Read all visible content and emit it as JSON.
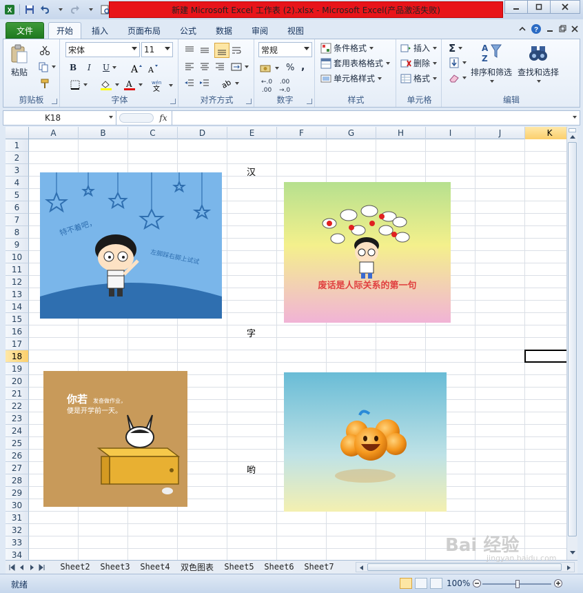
{
  "window": {
    "title": "新建 Microsoft Excel 工作表 (2).xlsx  -  Microsoft Excel(产品激活失败)"
  },
  "tabs": [
    "文件",
    "开始",
    "插入",
    "页面布局",
    "公式",
    "数据",
    "审阅",
    "视图"
  ],
  "active_tab": "开始",
  "ribbon": {
    "clipboard": {
      "label": "剪贴板",
      "paste": "粘贴"
    },
    "font": {
      "label": "字体",
      "name": "宋体",
      "size": "11",
      "bold": "B",
      "italic": "I",
      "underline": "U"
    },
    "alignment": {
      "label": "对齐方式"
    },
    "number": {
      "label": "数字",
      "format": "常规",
      "percent": "%",
      "comma": ",",
      "inc_decimal": ".00",
      "dec_decimal": ".00"
    },
    "styles": {
      "label": "样式",
      "conditional": "条件格式",
      "table": "套用表格格式",
      "cell": "单元格样式"
    },
    "cells": {
      "label": "单元格",
      "insert": "插入",
      "delete": "删除",
      "format": "格式"
    },
    "editing": {
      "label": "编辑",
      "sort": "排序和筛选",
      "find": "查找和选择",
      "sum": "Σ"
    }
  },
  "formula_bar": {
    "name_box": "K18",
    "fx": "fx",
    "value": ""
  },
  "columns": [
    "A",
    "B",
    "C",
    "D",
    "E",
    "F",
    "G",
    "H",
    "I",
    "J",
    "K"
  ],
  "selected_column": "K",
  "rows": [
    "1",
    "2",
    "3",
    "4",
    "5",
    "6",
    "7",
    "8",
    "9",
    "10",
    "11",
    "12",
    "13",
    "14",
    "15",
    "16",
    "17",
    "18",
    "19",
    "20",
    "21",
    "22",
    "23",
    "24",
    "25",
    "26",
    "27",
    "28",
    "29",
    "30",
    "31",
    "32",
    "33",
    "34"
  ],
  "selected_row": "18",
  "cells": [
    {
      "ref": "E3",
      "text": "汉"
    },
    {
      "ref": "E16",
      "text": "字"
    },
    {
      "ref": "E27",
      "text": "哟"
    }
  ],
  "pictures": [
    {
      "name": "picture-cartoon-boy-stars",
      "caption_text": "特不着吧，左脚踩右脚上试试"
    },
    {
      "name": "picture-cartoon-boy-speech",
      "caption_text": "废话是人际关系的第一句"
    },
    {
      "name": "picture-cartoon-cat-desk",
      "caption_text": "你若 发奋做作业，便是开学前一天。"
    },
    {
      "name": "picture-smiley-balls"
    }
  ],
  "sheet_tabs": [
    "Sheet2",
    "Sheet3",
    "Sheet4",
    "双色图表",
    "Sheet5",
    "Sheet6",
    "Sheet7"
  ],
  "status": {
    "ready": "就绪",
    "zoom": "100%"
  },
  "watermark": {
    "brand": "Bai 经验",
    "sub": "jingyan.baidu.com"
  },
  "colors": {
    "file_tab": "#2a8a2a",
    "title_highlight": "#e8141a",
    "selection": "#fbcf6c"
  }
}
